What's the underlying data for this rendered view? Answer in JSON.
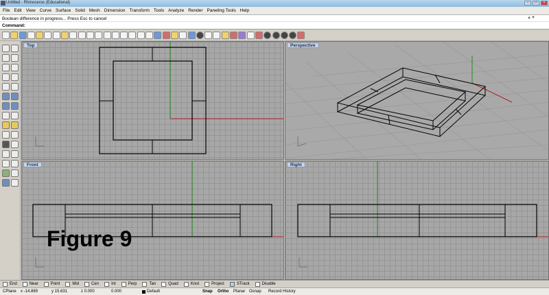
{
  "window": {
    "title": "Untitled - Rhinoceros (Educational)"
  },
  "menu": [
    "File",
    "Edit",
    "View",
    "Curve",
    "Surface",
    "Solid",
    "Mesh",
    "Dimension",
    "Transform",
    "Tools",
    "Analyze",
    "Render",
    "Paneling Tools",
    "Help"
  ],
  "history": {
    "text": "Boolean difference in progress... Press Esc to cancel"
  },
  "command": {
    "label": "Command:",
    "value": ""
  },
  "viewports": {
    "top": "Top",
    "perspective": "Perspective",
    "front": "Front",
    "right": "Right"
  },
  "figure_label": "Figure 9",
  "osnap": [
    {
      "label": "End",
      "checked": false
    },
    {
      "label": "Near",
      "checked": false
    },
    {
      "label": "Point",
      "checked": false
    },
    {
      "label": "Mid",
      "checked": false
    },
    {
      "label": "Cen",
      "checked": false
    },
    {
      "label": "Int",
      "checked": false
    },
    {
      "label": "Perp",
      "checked": false
    },
    {
      "label": "Tan",
      "checked": false
    },
    {
      "label": "Quad",
      "checked": false
    },
    {
      "label": "Knot",
      "checked": false
    },
    {
      "label": "Project",
      "checked": false
    },
    {
      "label": "STrack",
      "checked": true
    },
    {
      "label": "Disable",
      "checked": false
    }
  ],
  "status": {
    "cplane": "CPlane",
    "x": "x -14.869",
    "y": "y 15.631",
    "z": "z 0.000",
    "extra": "0.000",
    "layer": "Default",
    "snap": "Snap",
    "ortho": "Ortho",
    "planar": "Planar",
    "osnap": "Osnap",
    "record_history": "Record History"
  },
  "colors": {
    "x_axis": "#b02020",
    "y_axis": "#1f8a1f",
    "viewport_bg": "#a7a7a7",
    "geometry": "#000000"
  }
}
